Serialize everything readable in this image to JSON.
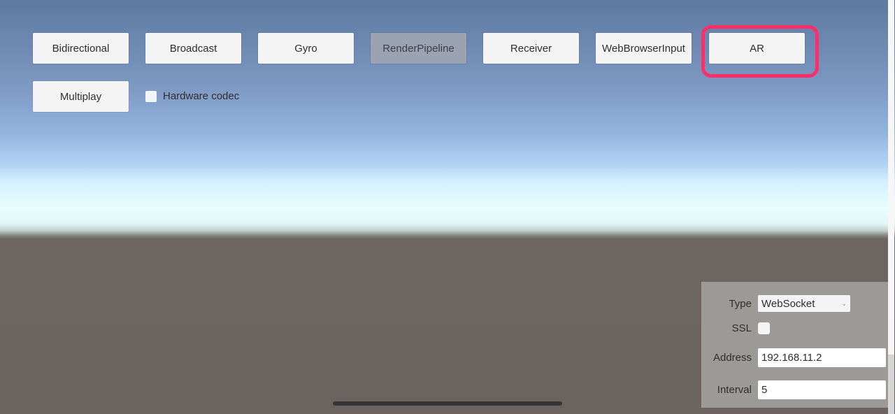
{
  "scene_buttons": [
    {
      "label": "Bidirectional",
      "state": "enabled"
    },
    {
      "label": "Broadcast",
      "state": "enabled"
    },
    {
      "label": "Gyro",
      "state": "enabled"
    },
    {
      "label": "RenderPipeline",
      "state": "disabled"
    },
    {
      "label": "Receiver",
      "state": "enabled"
    },
    {
      "label": "WebBrowserInput",
      "state": "enabled"
    },
    {
      "label": "AR",
      "state": "enabled",
      "highlighted": true
    },
    {
      "label": "Multiplay",
      "state": "enabled"
    }
  ],
  "hardware_codec": {
    "label": "Hardware codec",
    "checked": false
  },
  "settings": {
    "type_label": "Type",
    "type_value": "WebSocket",
    "ssl_label": "SSL",
    "ssl_checked": false,
    "address_label": "Address",
    "address_value": "192.168.11.2",
    "interval_label": "Interval",
    "interval_value": "5"
  },
  "colors": {
    "highlight": "#ff2d6a",
    "button_bg": "#f4f4f4",
    "button_disabled_bg": "#9ba2b1",
    "panel_bg": "#9c9a96"
  }
}
